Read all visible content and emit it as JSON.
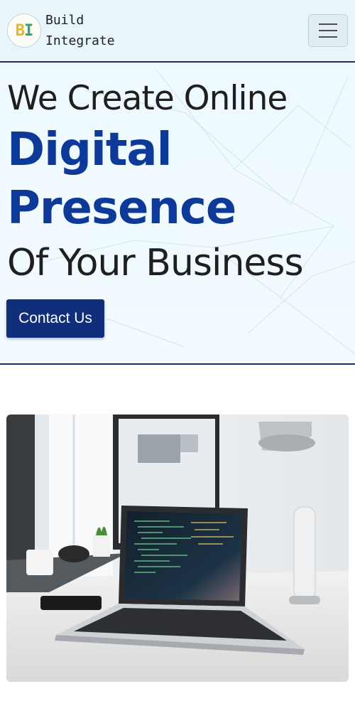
{
  "brand": {
    "logo_b": "B",
    "logo_i": "I",
    "line1": "Build",
    "line2": "Integrate"
  },
  "nav": {
    "toggler_icon": "hamburger-menu-icon"
  },
  "hero": {
    "line1": "We Create Online",
    "line2": "Digital",
    "line3": "Presence",
    "line4": "Of Your Business",
    "cta_label": "Contact Us"
  },
  "photo": {
    "subject": "laptop-workspace-image"
  },
  "colors": {
    "accent_blue": "#0d3a99",
    "button_bg": "#102e7a",
    "nav_bg": "#e8f6fc"
  }
}
